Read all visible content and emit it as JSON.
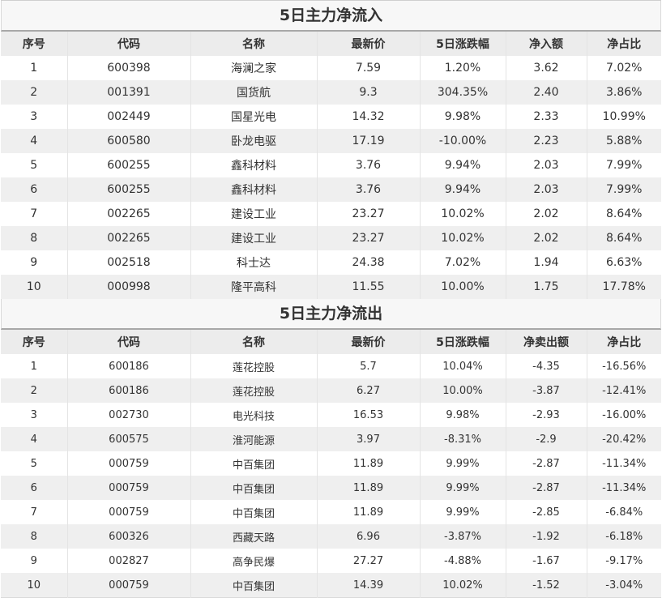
{
  "inflow": {
    "title": "5日主力净流入",
    "headers": [
      "序号",
      "代码",
      "名称",
      "最新价",
      "5日涨跌幅",
      "净入额",
      "净占比"
    ],
    "rows": [
      [
        "1",
        "600398",
        "海澜之家",
        "7.59",
        "1.20%",
        "3.62",
        "7.02%"
      ],
      [
        "2",
        "001391",
        "国货航",
        "9.3",
        "304.35%",
        "2.40",
        "3.86%"
      ],
      [
        "3",
        "002449",
        "国星光电",
        "14.32",
        "9.98%",
        "2.33",
        "10.99%"
      ],
      [
        "4",
        "600580",
        "卧龙电驱",
        "17.19",
        "-10.00%",
        "2.23",
        "5.88%"
      ],
      [
        "5",
        "600255",
        "鑫科材料",
        "3.76",
        "9.94%",
        "2.03",
        "7.99%"
      ],
      [
        "6",
        "600255",
        "鑫科材料",
        "3.76",
        "9.94%",
        "2.03",
        "7.99%"
      ],
      [
        "7",
        "002265",
        "建设工业",
        "23.27",
        "10.02%",
        "2.02",
        "8.64%"
      ],
      [
        "8",
        "002265",
        "建设工业",
        "23.27",
        "10.02%",
        "2.02",
        "8.64%"
      ],
      [
        "9",
        "002518",
        "科士达",
        "24.38",
        "7.02%",
        "1.94",
        "6.63%"
      ],
      [
        "10",
        "000998",
        "隆平高科",
        "11.55",
        "10.00%",
        "1.75",
        "17.78%"
      ]
    ]
  },
  "outflow": {
    "title": "5日主力净流出",
    "headers": [
      "序号",
      "代码",
      "名称",
      "最新价",
      "5日涨跌幅",
      "净卖出额",
      "净占比"
    ],
    "rows": [
      [
        "1",
        "600186",
        "莲花控股",
        "5.7",
        "10.04%",
        "-4.35",
        "-16.56%"
      ],
      [
        "2",
        "600186",
        "莲花控股",
        "6.27",
        "10.00%",
        "-3.87",
        "-12.41%"
      ],
      [
        "3",
        "002730",
        "电光科技",
        "16.53",
        "9.98%",
        "-2.93",
        "-16.00%"
      ],
      [
        "4",
        "600575",
        "淮河能源",
        "3.97",
        "-8.31%",
        "-2.9",
        "-20.42%"
      ],
      [
        "5",
        "000759",
        "中百集团",
        "11.89",
        "9.99%",
        "-2.87",
        "-11.34%"
      ],
      [
        "6",
        "000759",
        "中百集团",
        "11.89",
        "9.99%",
        "-2.87",
        "-11.34%"
      ],
      [
        "7",
        "000759",
        "中百集团",
        "11.89",
        "9.99%",
        "-2.85",
        "-6.84%"
      ],
      [
        "8",
        "600326",
        "西藏天路",
        "6.96",
        "-3.87%",
        "-1.92",
        "-6.18%"
      ],
      [
        "9",
        "002827",
        "高争民爆",
        "27.27",
        "-4.88%",
        "-1.67",
        "-9.17%"
      ],
      [
        "10",
        "000759",
        "中百集团",
        "14.39",
        "10.02%",
        "-1.52",
        "-3.04%"
      ]
    ]
  }
}
